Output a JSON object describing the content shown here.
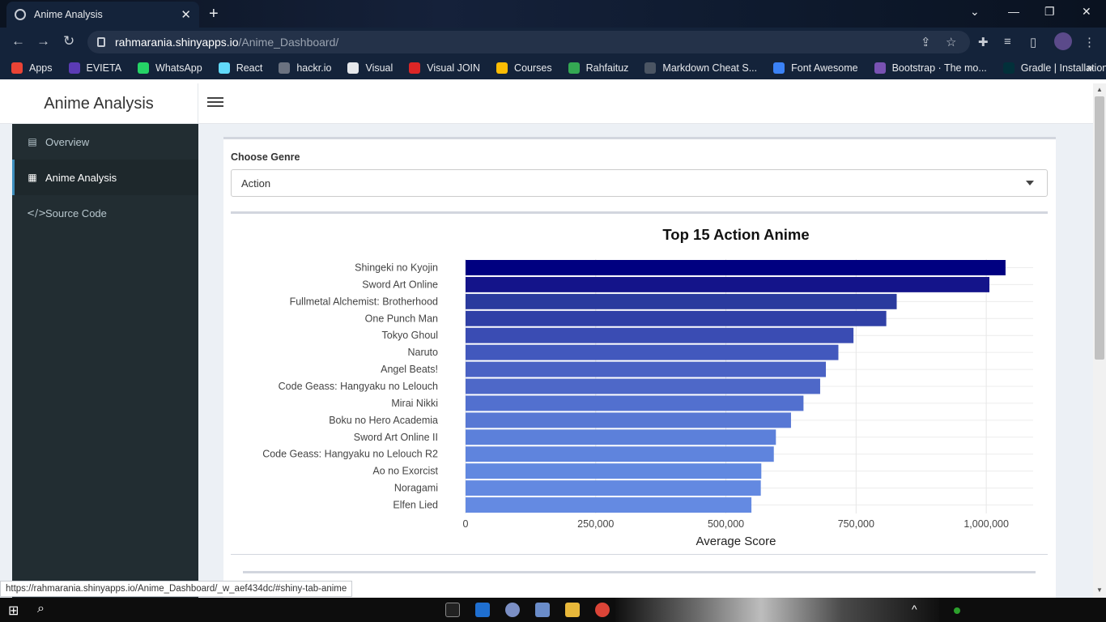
{
  "browser": {
    "tab_title": "Anime Analysis",
    "url_host": "rahmarania.shinyapps.io",
    "url_path": "/Anime_Dashboard/",
    "bookmarks": [
      {
        "label": "Apps",
        "color": "#ea4335"
      },
      {
        "label": "EVIETA",
        "color": "#5b3bb5"
      },
      {
        "label": "WhatsApp",
        "color": "#25d366"
      },
      {
        "label": "React",
        "color": "#61dafb"
      },
      {
        "label": "hackr.io",
        "color": "#6b7280"
      },
      {
        "label": "Visual",
        "color": "#e5e7eb"
      },
      {
        "label": "Visual JOIN",
        "color": "#dc2626"
      },
      {
        "label": "Courses",
        "color": "#fbbc04"
      },
      {
        "label": "Rahfaituz",
        "color": "#34a853"
      },
      {
        "label": "Markdown Cheat S...",
        "color": "#4b5563"
      },
      {
        "label": "Font Awesome",
        "color": "#3b82f6"
      },
      {
        "label": "Bootstrap · The mo...",
        "color": "#7952b3"
      },
      {
        "label": "Gradle | Installation",
        "color": "#02303a"
      }
    ],
    "status_url": "https://rahmarania.shinyapps.io/Anime_Dashboard/_w_aef434dc/#shiny-tab-anime"
  },
  "app": {
    "title": "Anime Analysis",
    "sidebar": [
      {
        "label": "Overview",
        "icon": "book-icon",
        "glyph": "▤",
        "active": false
      },
      {
        "label": "Anime Analysis",
        "icon": "film-icon",
        "glyph": "▦",
        "active": true
      },
      {
        "label": "Source Code",
        "icon": "code-icon",
        "glyph": "</>",
        "active": false
      }
    ],
    "genre_label": "Choose Genre",
    "genre_selected": "Action"
  },
  "chart_data": {
    "type": "bar",
    "orientation": "horizontal",
    "title": "Top 15 Action Anime",
    "xlabel": "Average Score",
    "ylabel": "",
    "xlim": [
      0,
      1090000
    ],
    "xticks": [
      0,
      250000,
      500000,
      750000,
      1000000
    ],
    "xtick_labels": [
      "0",
      "250,000",
      "500,000",
      "750,000",
      "1,000,000"
    ],
    "grid": true,
    "categories": [
      "Shingeki no Kyojin",
      "Sword Art Online",
      "Fullmetal Alchemist: Brotherhood",
      "One Punch Man",
      "Tokyo Ghoul",
      "Naruto",
      "Angel Beats!",
      "Code Geass: Hangyaku no Lelouch",
      "Mirai Nikki",
      "Boku no Hero Academia",
      "Sword Art Online II",
      "Code Geass: Hangyaku no Lelouch R2",
      "Ao no Exorcist",
      "Noragami",
      "Elfen Lied"
    ],
    "values": [
      1037000,
      1006000,
      828000,
      808000,
      745000,
      716000,
      692000,
      681000,
      649000,
      625000,
      596000,
      592000,
      568000,
      567000,
      549000
    ],
    "colors": [
      "#000080",
      "#14148a",
      "#2a3a9e",
      "#3040a6",
      "#3a4cb3",
      "#4258bd",
      "#4a62c4",
      "#4e68c8",
      "#5270cf",
      "#5878d4",
      "#5c80da",
      "#5f84dd",
      "#6188e0",
      "#6389e1",
      "#648ae2"
    ]
  }
}
